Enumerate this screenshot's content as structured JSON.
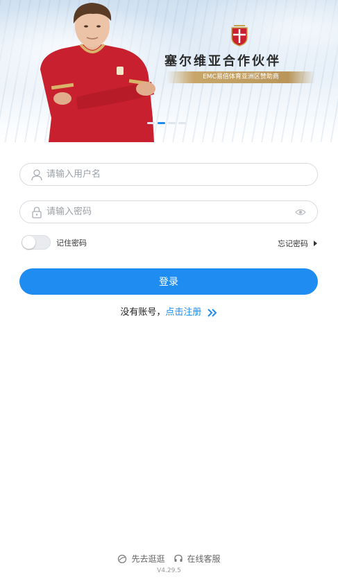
{
  "banner": {
    "title": "塞尔维亚合作伙伴",
    "subtitle": "EMC易倍体育亚洲区赞助商",
    "slides": 4,
    "active_slide": 2,
    "jersey_color": "#c8202e",
    "accent_color": "#1e8cf0"
  },
  "login": {
    "username_placeholder": "请输入用户名",
    "password_placeholder": "请输入密码",
    "remember_label": "记住密码",
    "remember_on": false,
    "forgot_label": "忘记密码",
    "submit_label": "登录",
    "no_account_text": "没有账号，",
    "register_link": "点击注册"
  },
  "footer": {
    "browse_label": "先去逛逛",
    "service_label": "在线客服",
    "version": "V4.29.5"
  }
}
